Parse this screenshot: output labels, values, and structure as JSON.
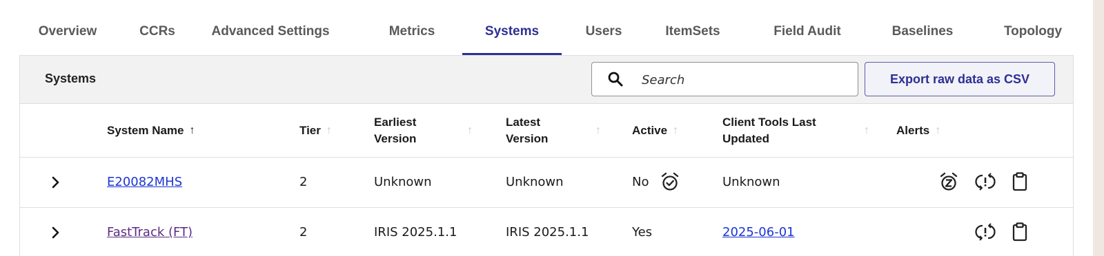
{
  "tabs": [
    {
      "label": "Overview",
      "active": false
    },
    {
      "label": "CCRs",
      "active": false
    },
    {
      "label": "Advanced Settings",
      "active": false
    },
    {
      "label": "Metrics",
      "active": false
    },
    {
      "label": "Systems",
      "active": true
    },
    {
      "label": "Users",
      "active": false
    },
    {
      "label": "ItemSets",
      "active": false
    },
    {
      "label": "Field Audit",
      "active": false
    },
    {
      "label": "Baselines",
      "active": false
    },
    {
      "label": "Topology",
      "active": false
    }
  ],
  "panel": {
    "title": "Systems",
    "search": {
      "placeholder": "Search",
      "icon": "search-icon"
    },
    "export_label": "Export raw data as CSV"
  },
  "table": {
    "columns": [
      {
        "label": "System Name",
        "sort": "ascending"
      },
      {
        "label": "Tier",
        "sort": "none"
      },
      {
        "label": "Earliest Version",
        "sort": "none"
      },
      {
        "label": "Latest Version",
        "sort": "none"
      },
      {
        "label": "Active",
        "sort": "none"
      },
      {
        "label": "Client Tools Last Updated",
        "sort": "none"
      },
      {
        "label": "Alerts",
        "sort": "none"
      }
    ],
    "rows": [
      {
        "system_name": "E20082MHS",
        "tier": "2",
        "earliest_version": "Unknown",
        "latest_version": "Unknown",
        "active": "No",
        "active_icon": "alarm-clock-check-icon",
        "client_tools_last_updated": "Unknown",
        "alerts": [
          "snooze-alarm-icon",
          "sync-alert-icon",
          "clipboard-icon"
        ]
      },
      {
        "system_name": "FastTrack (FT)",
        "tier": "2",
        "earliest_version": "IRIS 2025.1.1",
        "latest_version": "IRIS 2025.1.1",
        "active": "Yes",
        "client_tools_last_updated": "2025-06-01",
        "alerts": [
          "sync-alert-icon",
          "clipboard-icon"
        ]
      }
    ]
  },
  "colors": {
    "accent": "#2d2f93",
    "link": "#1a35d4",
    "visited_link": "#5b2a86",
    "header_bg": "#f2f2f2"
  }
}
